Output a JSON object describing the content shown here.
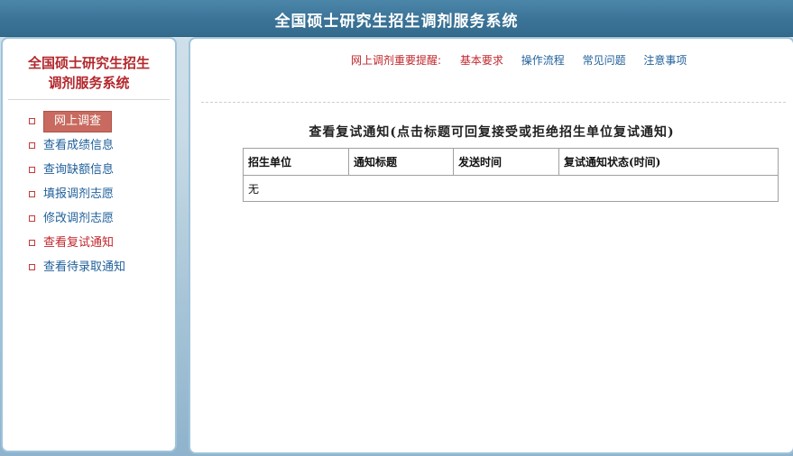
{
  "header": {
    "title": "全国硕士研究生招生调剂服务系统"
  },
  "sidebar": {
    "brand_line1": "全国硕士研究生招生",
    "brand_line2": "调剂服务系统",
    "items": [
      {
        "label": "网上调查"
      },
      {
        "label": "查看成绩信息"
      },
      {
        "label": "查询缺额信息"
      },
      {
        "label": "填报调剂志愿"
      },
      {
        "label": "修改调剂志愿"
      },
      {
        "label": "查看复试通知"
      },
      {
        "label": "查看待录取通知"
      }
    ]
  },
  "notice": {
    "label": "网上调剂重要提醒:",
    "links": [
      "基本要求",
      "操作流程",
      "常见问题",
      "注意事项"
    ]
  },
  "main": {
    "title": "查看复试通知(点击标题可回复接受或拒绝招生单位复试通知)",
    "table": {
      "headers": [
        "招生单位",
        "通知标题",
        "发送时间",
        "复试通知状态(时间)"
      ],
      "empty_text": "无"
    }
  },
  "colors": {
    "header_bg": "#3b7397",
    "brand_red": "#b3282d",
    "link_blue": "#1f5f9a",
    "active_item_bg": "#c86a5f",
    "panel_border": "#9ec3db"
  }
}
